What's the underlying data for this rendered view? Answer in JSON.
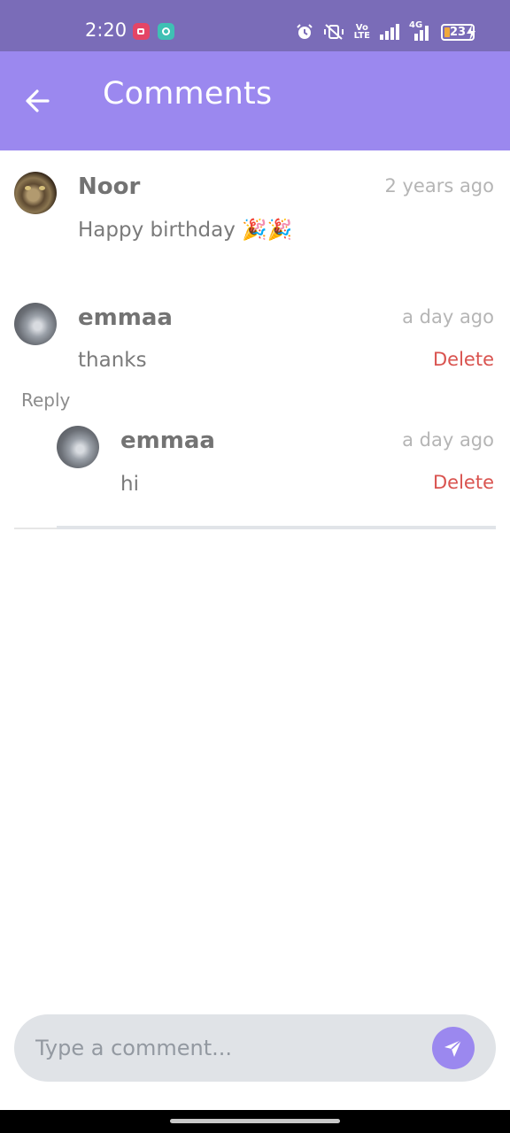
{
  "status_bar": {
    "time": "2:20",
    "battery": "23",
    "network_label": "4G",
    "volte_label_top": "Vo",
    "volte_label_bottom": "LTE"
  },
  "app_bar": {
    "title": "Comments"
  },
  "comments": [
    {
      "author": "Noor",
      "time": "2 years ago",
      "text": "Happy birthday 🎉🎉"
    },
    {
      "author": "emmaa",
      "time": "a day ago",
      "text": "thanks",
      "delete_label": "Delete",
      "reply_label": "Reply",
      "replies": [
        {
          "author": "emmaa",
          "time": "a day ago",
          "text": "hi",
          "delete_label": "Delete"
        }
      ]
    }
  ],
  "composer": {
    "placeholder": "Type a comment..."
  },
  "colors": {
    "status_bar": "#7a6cb8",
    "app_bar": "#9b88ef",
    "delete": "#d9534f",
    "composer_bg": "#e0e3e7"
  }
}
